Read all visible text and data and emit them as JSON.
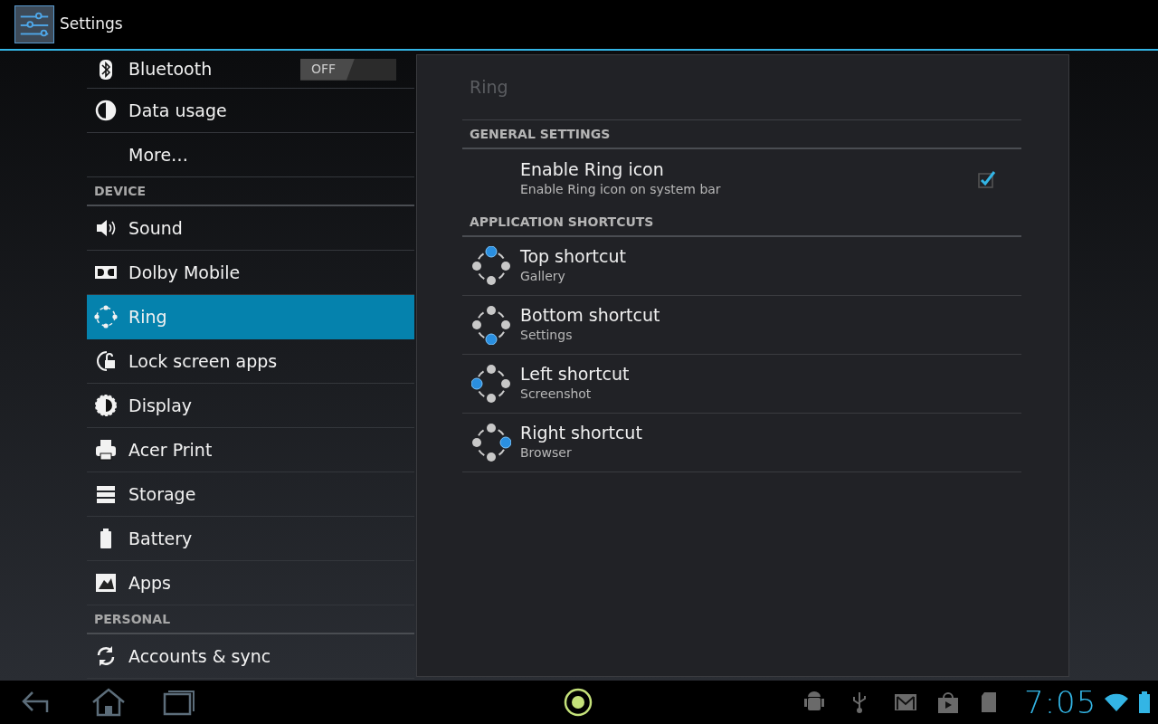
{
  "action_bar": {
    "title": "Settings"
  },
  "sidebar": {
    "items": [
      {
        "kind": "item",
        "label": "Bluetooth",
        "selected": false,
        "toggle": {
          "label": "OFF",
          "on": false
        }
      },
      {
        "kind": "item",
        "label": "Data usage",
        "selected": false
      },
      {
        "kind": "item",
        "label": "More…",
        "selected": false
      },
      {
        "kind": "header",
        "label": "DEVICE"
      },
      {
        "kind": "item",
        "label": "Sound",
        "selected": false
      },
      {
        "kind": "item",
        "label": "Dolby Mobile",
        "selected": false
      },
      {
        "kind": "item",
        "label": "Ring",
        "selected": true
      },
      {
        "kind": "item",
        "label": "Lock screen apps",
        "selected": false
      },
      {
        "kind": "item",
        "label": "Display",
        "selected": false
      },
      {
        "kind": "item",
        "label": "Acer Print",
        "selected": false
      },
      {
        "kind": "item",
        "label": "Storage",
        "selected": false
      },
      {
        "kind": "item",
        "label": "Battery",
        "selected": false
      },
      {
        "kind": "item",
        "label": "Apps",
        "selected": false
      },
      {
        "kind": "header",
        "label": "PERSONAL"
      },
      {
        "kind": "item",
        "label": "Accounts & sync",
        "selected": false
      }
    ]
  },
  "detail": {
    "title": "Ring",
    "sections": [
      {
        "header": "GENERAL SETTINGS",
        "items": [
          {
            "kind": "checkbox",
            "title": "Enable Ring icon",
            "summary": "Enable Ring icon on system bar",
            "checked": true
          }
        ]
      },
      {
        "header": "APPLICATION SHORTCUTS",
        "items": [
          {
            "kind": "top",
            "title": "Top shortcut",
            "summary": "Gallery"
          },
          {
            "kind": "bottom",
            "title": "Bottom shortcut",
            "summary": "Settings"
          },
          {
            "kind": "left",
            "title": "Left shortcut",
            "summary": "Screenshot"
          },
          {
            "kind": "right",
            "title": "Right shortcut",
            "summary": "Browser"
          }
        ]
      }
    ]
  },
  "system_bar": {
    "clock": "7:05"
  }
}
